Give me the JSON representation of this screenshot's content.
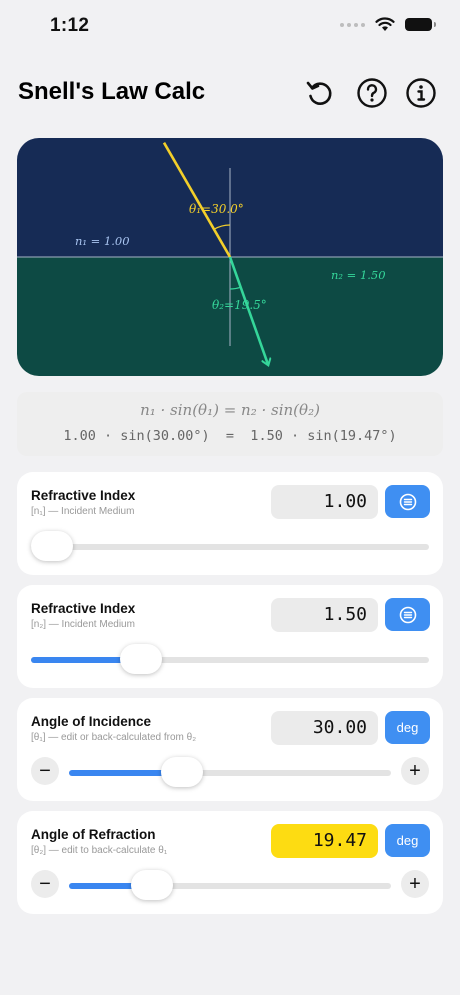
{
  "status": {
    "time": "1:12"
  },
  "header": {
    "title": "Snell's Law Calc"
  },
  "icons": {
    "reset": "reset-icon",
    "help": "help-icon",
    "info": "info-icon",
    "list": "list-icon",
    "wifi": "wifi-icon",
    "battery": "battery-icon"
  },
  "diagram": {
    "theta1_label": "θ₁=30.0°",
    "theta2_label": "θ₂=19.5°",
    "n1_label": "n₁ = 1.00",
    "n2_label": "n₂ = 1.50",
    "incident_angle_deg": 30.0,
    "refracted_angle_deg": 19.47,
    "colors": {
      "top": "#162b55",
      "bottom": "#0d4a44",
      "incident": "#f3cf2a",
      "refracted": "#35d69a"
    }
  },
  "formula": {
    "equation": "n₁ · sin(θ₁) = n₂ · sin(θ₂)",
    "numeric": "1.00 · sin(30.00°)  =  1.50 · sin(19.47°)"
  },
  "cards": [
    {
      "title": "Refractive Index",
      "subtitle": "[n₁] — Incident Medium",
      "value": "1.00",
      "button": "",
      "slider_fraction": 0.0
    },
    {
      "title": "Refractive Index",
      "subtitle": "[n₂] — Incident Medium",
      "value": "1.50",
      "button": "",
      "slider_fraction": 0.25
    },
    {
      "title": "Angle of Incidence",
      "subtitle": "[θ₁] — edit or back-calculated from θ₂",
      "value": "30.00",
      "button": "deg",
      "slider_fraction": 0.33,
      "minus": "−",
      "plus": "+"
    },
    {
      "title": "Angle of Refraction",
      "subtitle": "[θ₂] — edit to back-calculate θ₁",
      "value": "19.47",
      "button": "deg",
      "slider_fraction": 0.22,
      "minus": "−",
      "plus": "+"
    }
  ]
}
